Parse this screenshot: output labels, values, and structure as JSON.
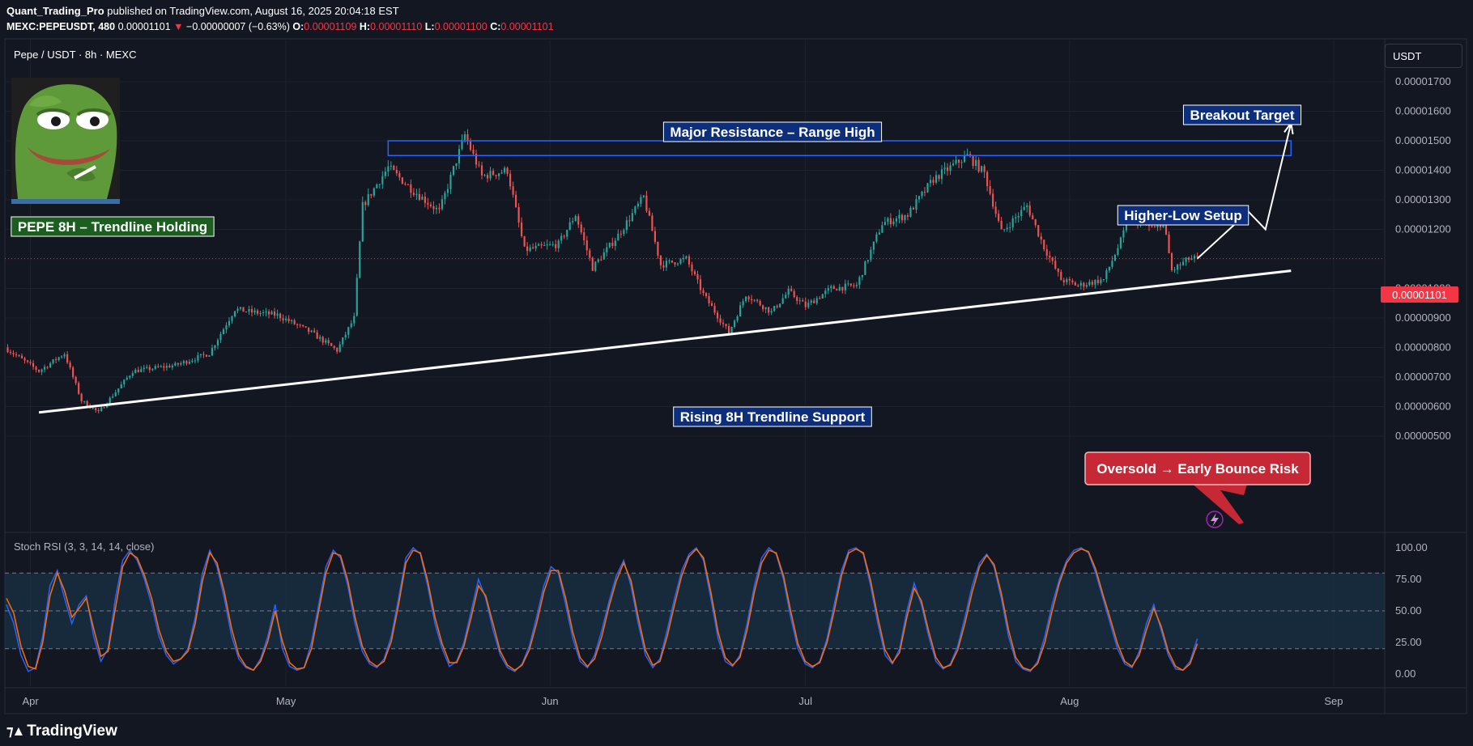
{
  "header": {
    "author": "Quant_Trading_Pro",
    "published": "published on TradingView.com, August 16, 2025 20:04:18 EST",
    "symbol": "MEXC:PEPEUSDT, 480",
    "last": "0.00001101",
    "change": "−0.00000007 (−0.63%)",
    "open": "0.00001109",
    "high": "0.00001110",
    "low": "0.00001100",
    "close": "0.00001101",
    "o_label": "O:",
    "h_label": "H:",
    "l_label": "L:",
    "c_label": "C:"
  },
  "pair_title": "Pepe / USDT · 8h · MEXC",
  "unit_button": "USDT",
  "rsi_title": "Stoch RSI (3, 3, 14, 14, close)",
  "footer_brand": "TradingView",
  "colors": {
    "background": "#131722",
    "up": "#26a69a",
    "down": "#ef5350",
    "price_line": "#f23645",
    "annotation_bg": "#0d2e7a",
    "annotation_border": "#ffffff",
    "zone_border": "#2962ff",
    "callout_red": "#c62835",
    "k_line": "#2962ff",
    "d_line": "#ff6d00"
  },
  "icons": {
    "logo": "pepe-frog-avatar",
    "alert": "lightning-icon",
    "brand": "tradingview-logo"
  },
  "chart_data": [
    {
      "type": "candlestick",
      "title": "Pepe / USDT · 8h · MEXC",
      "x_axis": {
        "labels": [
          "Apr",
          "May",
          "Jun",
          "Jul",
          "Aug",
          "Sep"
        ],
        "range": [
          "2025-03-29",
          "2025-09-07"
        ]
      },
      "y_axis": {
        "ticks": [
          "0.00001700",
          "0.00001600",
          "0.00001500",
          "0.00001400",
          "0.00001300",
          "0.00001200",
          "0.00001000",
          "0.00000900",
          "0.00000800",
          "0.00000700",
          "0.00000600",
          "0.00000500"
        ],
        "range": [
          4.3e-06,
          1.78e-05
        ],
        "position": "right"
      },
      "last_price_label": "0.00001101",
      "price_path": [
        [
          "2025-03-29",
          8e-06
        ],
        [
          "2025-04-02",
          7.2e-06
        ],
        [
          "2025-04-05",
          7.8e-06
        ],
        [
          "2025-04-07",
          6.2e-06
        ],
        [
          "2025-04-09",
          5.8e-06
        ],
        [
          "2025-04-13",
          7.2e-06
        ],
        [
          "2025-04-18",
          7.4e-06
        ],
        [
          "2025-04-22",
          7.8e-06
        ],
        [
          "2025-04-25",
          9.3e-06
        ],
        [
          "2025-04-27",
          9.2e-06
        ],
        [
          "2025-04-30",
          9.1e-06
        ],
        [
          "2025-05-04",
          8.5e-06
        ],
        [
          "2025-05-07",
          7.9e-06
        ],
        [
          "2025-05-09",
          9e-06
        ],
        [
          "2025-05-10",
          1.28e-05
        ],
        [
          "2025-05-13",
          1.41e-05
        ],
        [
          "2025-05-16",
          1.33e-05
        ],
        [
          "2025-05-19",
          1.26e-05
        ],
        [
          "2025-05-22",
          1.52e-05
        ],
        [
          "2025-05-24",
          1.38e-05
        ],
        [
          "2025-05-27",
          1.4e-05
        ],
        [
          "2025-05-29",
          1.13e-05
        ],
        [
          "2025-06-02",
          1.15e-05
        ],
        [
          "2025-06-04",
          1.25e-05
        ],
        [
          "2025-06-06",
          1.07e-05
        ],
        [
          "2025-06-09",
          1.18e-05
        ],
        [
          "2025-06-12",
          1.31e-05
        ],
        [
          "2025-06-14",
          1.08e-05
        ],
        [
          "2025-06-17",
          1.1e-05
        ],
        [
          "2025-06-19",
          9.8e-06
        ],
        [
          "2025-06-22",
          8.5e-06
        ],
        [
          "2025-06-24",
          9.8e-06
        ],
        [
          "2025-06-27",
          9.2e-06
        ],
        [
          "2025-06-29",
          9.9e-06
        ],
        [
          "2025-07-01",
          9.4e-06
        ],
        [
          "2025-07-04",
          1e-05
        ],
        [
          "2025-07-07",
          1.01e-05
        ],
        [
          "2025-07-10",
          1.22e-05
        ],
        [
          "2025-07-13",
          1.25e-05
        ],
        [
          "2025-07-16",
          1.37e-05
        ],
        [
          "2025-07-20",
          1.45e-05
        ],
        [
          "2025-07-22",
          1.39e-05
        ],
        [
          "2025-07-24",
          1.19e-05
        ],
        [
          "2025-07-27",
          1.28e-05
        ],
        [
          "2025-07-29",
          1.14e-05
        ],
        [
          "2025-07-31",
          1.03e-05
        ],
        [
          "2025-08-02",
          1.01e-05
        ],
        [
          "2025-08-05",
          1.03e-05
        ],
        [
          "2025-08-07",
          1.16e-05
        ],
        [
          "2025-08-08",
          1.24e-05
        ],
        [
          "2025-08-11",
          1.2e-05
        ],
        [
          "2025-08-12",
          1.23e-05
        ],
        [
          "2025-08-13",
          1.06e-05
        ],
        [
          "2025-08-15",
          1.1e-05
        ],
        [
          "2025-08-16",
          1.101e-05
        ]
      ],
      "annotations": [
        {
          "label": "Major Resistance – Range High",
          "zone_low": 1.45e-05,
          "zone_high": 1.5e-05,
          "from": "2025-05-13",
          "to": "2025-08-27"
        },
        {
          "label": "Rising 8H Trendline Support",
          "from": [
            "2025-04-02",
            5.8e-06
          ],
          "to": [
            "2025-08-27",
            1.06e-05
          ]
        },
        {
          "label": "Higher-Low Setup"
        },
        {
          "label": "Breakout Target",
          "path": [
            [
              "2025-08-16",
              1.101e-05
            ],
            [
              "2025-08-22",
              1.26e-05
            ],
            [
              "2025-08-24",
              1.2e-05
            ],
            [
              "2025-08-27",
              1.56e-05
            ]
          ]
        },
        {
          "label": "PEPE 8H – Trendline Holding"
        },
        {
          "label": "Oversold → Early Bounce Risk"
        }
      ]
    },
    {
      "type": "line",
      "title": "Stoch RSI (3, 3, 14, 14, close)",
      "y_axis": {
        "ticks": [
          "100.00",
          "75.00",
          "50.00",
          "25.00",
          "0.00"
        ],
        "range": [
          -5,
          105
        ]
      },
      "bands": {
        "upper": 80,
        "middle": 50,
        "lower": 20
      },
      "series": [
        {
          "key": "K",
          "color": "#2962ff",
          "values": [
            55,
            40,
            15,
            2,
            5,
            30,
            70,
            82,
            60,
            40,
            55,
            62,
            30,
            10,
            20,
            60,
            90,
            98,
            90,
            75,
            55,
            30,
            15,
            8,
            12,
            20,
            45,
            80,
            98,
            85,
            60,
            30,
            12,
            5,
            3,
            12,
            30,
            55,
            20,
            6,
            3,
            5,
            25,
            55,
            85,
            98,
            92,
            70,
            40,
            18,
            8,
            5,
            12,
            30,
            60,
            92,
            100,
            95,
            70,
            40,
            20,
            6,
            10,
            25,
            50,
            75,
            60,
            35,
            15,
            5,
            2,
            8,
            22,
            45,
            70,
            85,
            80,
            55,
            28,
            10,
            5,
            15,
            35,
            58,
            78,
            90,
            70,
            40,
            15,
            5,
            12,
            35,
            60,
            82,
            95,
            100,
            90,
            60,
            28,
            10,
            6,
            15,
            40,
            70,
            92,
            100,
            95,
            75,
            45,
            20,
            8,
            5,
            10,
            28,
            55,
            82,
            98,
            100,
            95,
            70,
            40,
            15,
            8,
            20,
            50,
            72,
            55,
            30,
            10,
            4,
            8,
            22,
            45,
            70,
            88,
            95,
            85,
            60,
            30,
            10,
            4,
            2,
            10,
            30,
            55,
            75,
            90,
            98,
            100,
            96,
            80,
            60,
            40,
            20,
            8,
            5,
            18,
            40,
            55,
            35,
            15,
            4,
            3,
            10,
            28
          ]
        },
        {
          "key": "D",
          "color": "#ff6d00",
          "values": [
            60,
            48,
            22,
            6,
            4,
            25,
            62,
            80,
            66,
            45,
            52,
            60,
            36,
            14,
            18,
            52,
            85,
            96,
            92,
            78,
            60,
            35,
            18,
            10,
            12,
            18,
            40,
            74,
            96,
            88,
            65,
            36,
            15,
            6,
            3,
            10,
            26,
            50,
            26,
            9,
            4,
            5,
            20,
            50,
            80,
            96,
            94,
            74,
            45,
            22,
            10,
            6,
            10,
            26,
            55,
            88,
            98,
            96,
            74,
            45,
            24,
            9,
            9,
            22,
            45,
            70,
            62,
            40,
            18,
            7,
            3,
            7,
            19,
            40,
            65,
            82,
            82,
            60,
            33,
            13,
            6,
            12,
            30,
            54,
            74,
            88,
            74,
            45,
            19,
            7,
            10,
            30,
            55,
            78,
            93,
            99,
            92,
            65,
            33,
            13,
            7,
            13,
            35,
            65,
            88,
            98,
            96,
            78,
            50,
            24,
            10,
            6,
            9,
            25,
            50,
            78,
            96,
            99,
            96,
            74,
            45,
            19,
            9,
            17,
            45,
            68,
            58,
            34,
            13,
            5,
            7,
            19,
            40,
            65,
            85,
            94,
            87,
            64,
            35,
            13,
            5,
            3,
            8,
            25,
            50,
            72,
            88,
            96,
            99,
            97,
            83,
            63,
            44,
            24,
            10,
            6,
            15,
            35,
            52,
            38,
            18,
            6,
            3,
            8,
            24
          ]
        }
      ]
    }
  ]
}
